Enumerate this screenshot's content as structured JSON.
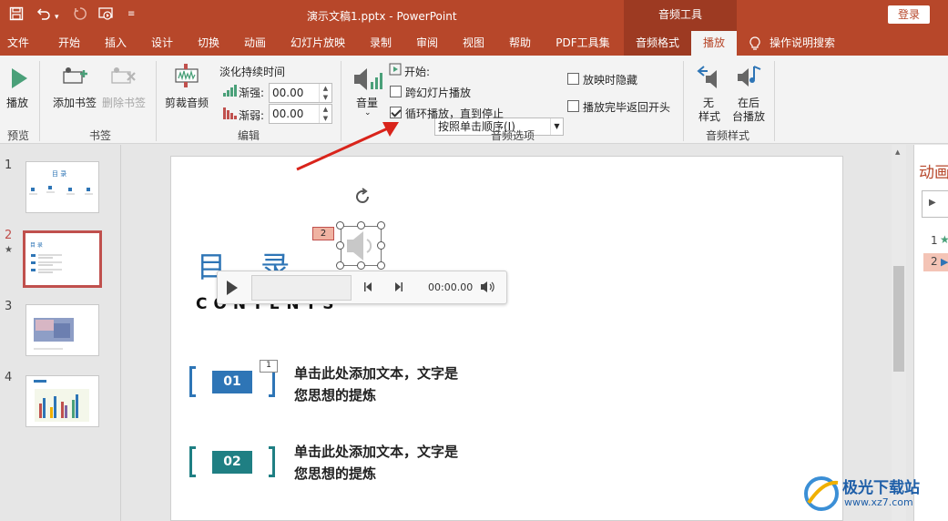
{
  "title_bar": {
    "document_title": "演示文稿1.pptx  -  PowerPoint",
    "context_group": "音频工具",
    "login": "登录"
  },
  "tabs": [
    "文件",
    "开始",
    "插入",
    "设计",
    "切换",
    "动画",
    "幻灯片放映",
    "录制",
    "审阅",
    "视图",
    "帮助",
    "PDF工具集",
    "音频格式",
    "播放",
    "操作说明搜索"
  ],
  "active_tab": "播放",
  "ribbon": {
    "preview": {
      "play": "播放",
      "group": "预览"
    },
    "bookmarks": {
      "add": "添加书签",
      "remove": "删除书签",
      "group": "书签"
    },
    "editing": {
      "trim": "剪裁音频",
      "fade_title": "淡化持续时间",
      "fade_in_label": "渐强:",
      "fade_in_value": "00.00",
      "fade_out_label": "渐弱:",
      "fade_out_value": "00.00",
      "group": "编辑"
    },
    "audio_options": {
      "volume": "音量",
      "start_label": "开始:",
      "start_value": "按照单击顺序(I)",
      "play_across_slides": "跨幻灯片播放",
      "loop_until_stopped": "循环播放，直到停止",
      "hide_during_show": "放映时隐藏",
      "rewind_after_playing": "播放完毕返回开头",
      "group": "音频选项"
    },
    "audio_styles": {
      "no_style_1": "无",
      "no_style_2": "样式",
      "play_bg_1": "在后",
      "play_bg_2": "台播放",
      "group": "音频样式"
    }
  },
  "slides": [
    {
      "number": "1",
      "starred": false
    },
    {
      "number": "2",
      "starred": true,
      "star": "★"
    },
    {
      "number": "3",
      "starred": false
    },
    {
      "number": "4",
      "starred": false
    }
  ],
  "slide_content": {
    "heading": "目 录",
    "subheading": "CONTENTS",
    "anim_badge": "2",
    "item_badge": "1",
    "items": [
      {
        "num": "01",
        "line1": "单击此处添加文本，文字是",
        "line2": "您思想的提炼"
      },
      {
        "num": "02",
        "line1": "单击此处添加文本，文字是",
        "line2": "您思想的提炼"
      }
    ]
  },
  "player": {
    "time": "00:00.00"
  },
  "animation_pane": {
    "title": "动画",
    "rows": [
      {
        "num": "1"
      },
      {
        "num": "2"
      }
    ]
  },
  "watermark": {
    "brand": "极光下载站",
    "url": "www.xz7.com"
  }
}
